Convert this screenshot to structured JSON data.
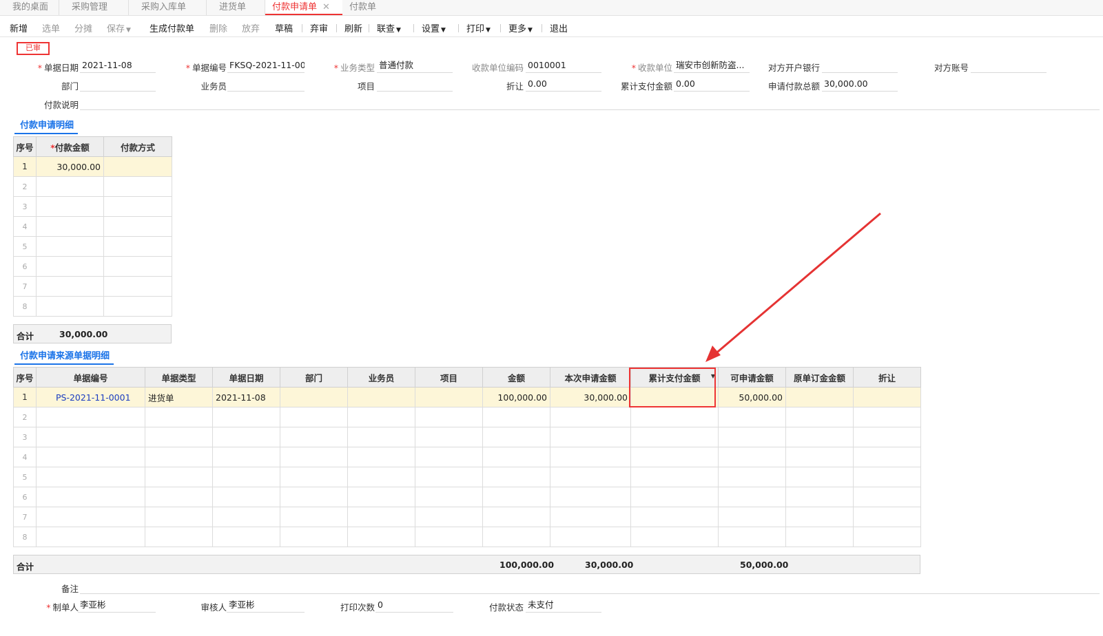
{
  "tabs": [
    {
      "label": "我的桌面"
    },
    {
      "label": "采购管理"
    },
    {
      "label": "采购入库单"
    },
    {
      "label": "进货单"
    },
    {
      "label": "付款申请单"
    },
    {
      "label": "付款单"
    }
  ],
  "toolbar": [
    {
      "label": "新增",
      "disabled": false
    },
    {
      "label": "选单",
      "disabled": true
    },
    {
      "label": "分摊",
      "disabled": true
    },
    {
      "label": "保存",
      "disabled": true
    },
    {
      "label": "生成付款单",
      "disabled": false
    },
    {
      "label": "删除",
      "disabled": true
    },
    {
      "label": "放弃",
      "disabled": true
    },
    {
      "label": "草稿",
      "disabled": false
    },
    {
      "label": "弃审",
      "disabled": false
    },
    {
      "label": "刷新",
      "disabled": false
    },
    {
      "label": "联查",
      "disabled": false
    },
    {
      "label": "设置",
      "disabled": false
    },
    {
      "label": "打印",
      "disabled": false
    },
    {
      "label": "更多",
      "disabled": false
    },
    {
      "label": "退出",
      "disabled": false
    }
  ],
  "stamp": "已审",
  "form": {
    "doc_date": {
      "label": "单据日期",
      "value": "2021-11-08"
    },
    "doc_no": {
      "label": "单据编号",
      "value": "FKSQ-2021-11-00..."
    },
    "biz_type": {
      "label": "业务类型",
      "value": "普通付款"
    },
    "payee_code": {
      "label": "收款单位编码",
      "value": "0010001"
    },
    "payee": {
      "label": "收款单位",
      "value": "瑞安市创新防盗..."
    },
    "bank": {
      "label": "对方开户银行",
      "value": ""
    },
    "account": {
      "label": "对方账号",
      "value": ""
    },
    "dept": {
      "label": "部门",
      "value": ""
    },
    "clerk": {
      "label": "业务员",
      "value": ""
    },
    "project": {
      "label": "项目",
      "value": ""
    },
    "discount": {
      "label": "折让",
      "value": "0.00"
    },
    "paid_total": {
      "label": "累计支付金额",
      "value": "0.00"
    },
    "apply_total": {
      "label": "申请付款总额",
      "value": "30,000.00"
    },
    "desc": {
      "label": "付款说明",
      "value": ""
    }
  },
  "detail": {
    "title": "付款申请明细",
    "headers": [
      "序号",
      "付款金额",
      "付款方式"
    ],
    "rows": [
      [
        "1",
        "30,000.00",
        ""
      ],
      [
        "2",
        "",
        ""
      ],
      [
        "3",
        "",
        ""
      ],
      [
        "4",
        "",
        ""
      ],
      [
        "5",
        "",
        ""
      ],
      [
        "6",
        "",
        ""
      ],
      [
        "7",
        "",
        ""
      ],
      [
        "8",
        "",
        ""
      ]
    ],
    "sum_label": "合计",
    "sum_value": "30,000.00"
  },
  "source": {
    "title": "付款申请来源单据明细",
    "headers": [
      "序号",
      "单据编号",
      "单据类型",
      "单据日期",
      "部门",
      "业务员",
      "项目",
      "金额",
      "本次申请金额",
      "累计支付金额",
      "可申请金额",
      "原单订金金额",
      "折让"
    ],
    "rows": [
      [
        "1",
        "PS-2021-11-0001",
        "进货单",
        "2021-11-08",
        "",
        "",
        "",
        "100,000.00",
        "30,000.00",
        "",
        "50,000.00",
        "",
        ""
      ],
      [
        "2",
        "",
        "",
        "",
        "",
        "",
        "",
        "",
        "",
        "",
        "",
        "",
        ""
      ],
      [
        "3",
        "",
        "",
        "",
        "",
        "",
        "",
        "",
        "",
        "",
        "",
        "",
        ""
      ],
      [
        "4",
        "",
        "",
        "",
        "",
        "",
        "",
        "",
        "",
        "",
        "",
        "",
        ""
      ],
      [
        "5",
        "",
        "",
        "",
        "",
        "",
        "",
        "",
        "",
        "",
        "",
        "",
        ""
      ],
      [
        "6",
        "",
        "",
        "",
        "",
        "",
        "",
        "",
        "",
        "",
        "",
        "",
        ""
      ],
      [
        "7",
        "",
        "",
        "",
        "",
        "",
        "",
        "",
        "",
        "",
        "",
        "",
        ""
      ],
      [
        "8",
        "",
        "",
        "",
        "",
        "",
        "",
        "",
        "",
        "",
        "",
        "",
        ""
      ]
    ],
    "sum_label": "合计",
    "sum_amount": "100,000.00",
    "sum_apply": "30,000.00",
    "sum_avail": "50,000.00"
  },
  "footer": {
    "remark": {
      "label": "备注",
      "value": ""
    },
    "maker": {
      "label": "制单人",
      "value": "李亚彬"
    },
    "auditor": {
      "label": "审核人",
      "value": "李亚彬"
    },
    "print_count": {
      "label": "打印次数",
      "value": "0"
    },
    "pay_status": {
      "label": "付款状态",
      "value": "未支付"
    }
  },
  "colors": {
    "accent": "#e53333",
    "link": "#1a73e8",
    "selected_row": "#fdf6d8"
  }
}
